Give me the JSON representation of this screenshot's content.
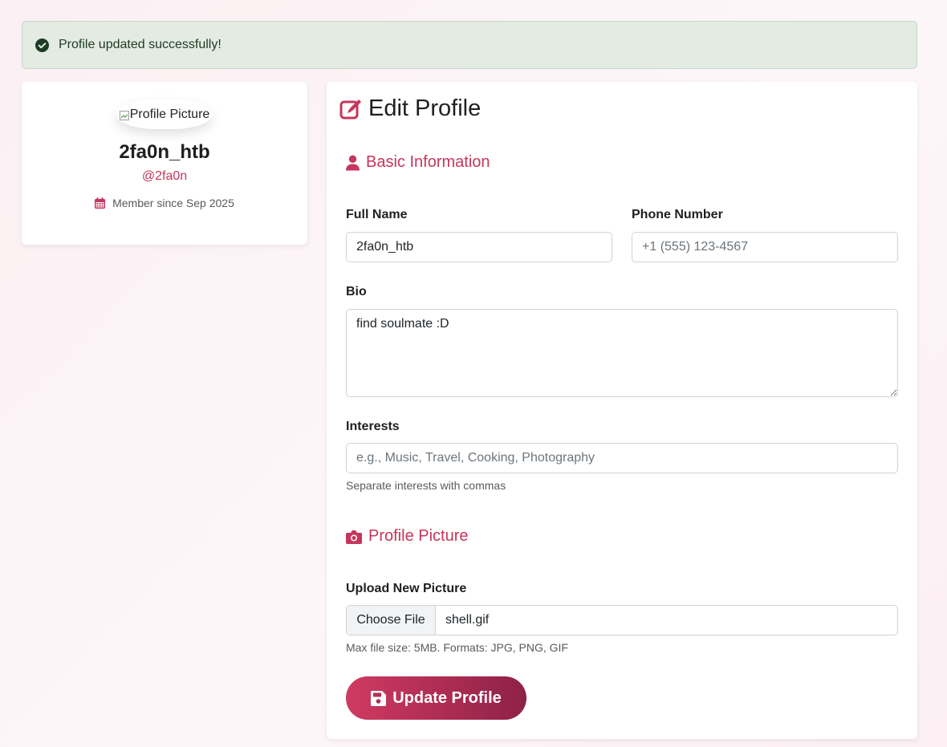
{
  "alert": {
    "message": "Profile updated successfully!",
    "icon": "check-circle-icon",
    "color": "#1e3b23"
  },
  "profile_card": {
    "avatar_alt": "Profile Picture",
    "display_name": "2fa0n_htb",
    "handle": "@2fa0n",
    "member_since": "Member since Sep 2025",
    "accent": "#c7355c"
  },
  "form": {
    "title": "Edit Profile",
    "basic_section": "Basic Information",
    "full_name_label": "Full Name",
    "full_name_value": "2fa0n_htb",
    "phone_label": "Phone Number",
    "phone_placeholder": "+1 (555) 123-4567",
    "bio_label": "Bio",
    "bio_value": "find soulmate :D",
    "interests_label": "Interests",
    "interests_placeholder": "e.g., Music, Travel, Cooking, Photography",
    "interests_help": "Separate interests with commas",
    "picture_section": "Profile Picture",
    "upload_label": "Upload New Picture",
    "choose_file": "Choose File",
    "file_name": "shell.gif",
    "file_help": "Max file size: 5MB. Formats: JPG, PNG, GIF",
    "submit_label": "Update Profile"
  }
}
